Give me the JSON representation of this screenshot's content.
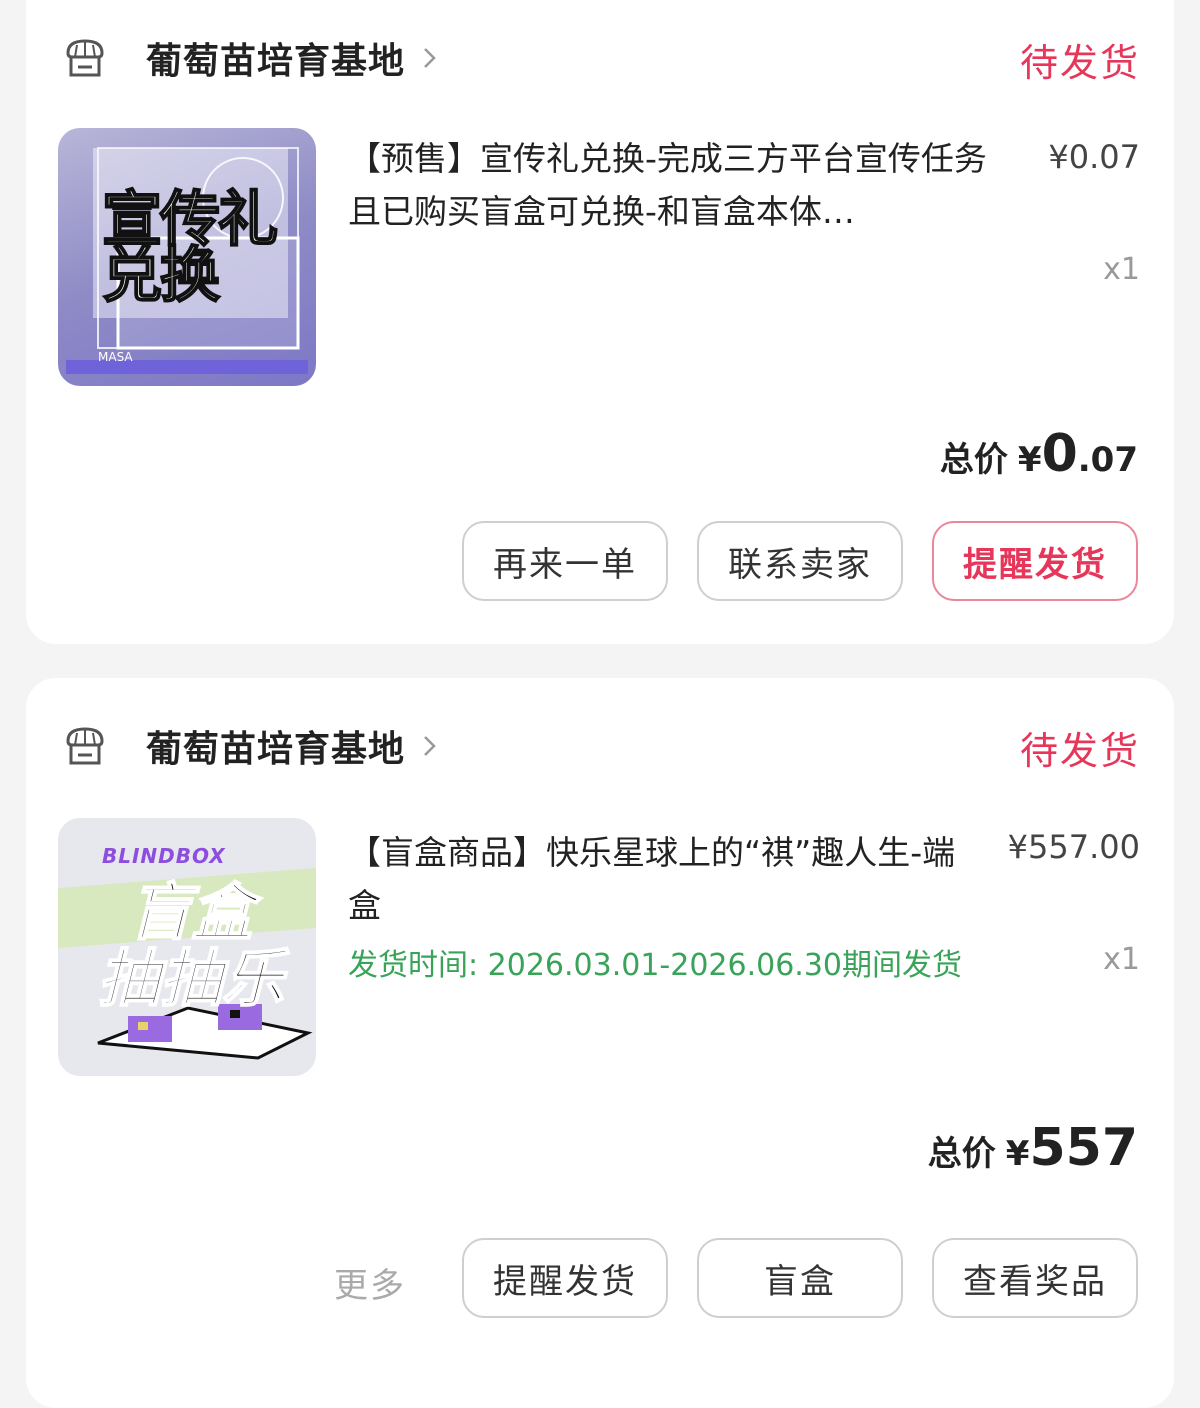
{
  "orders": [
    {
      "shop_name": "葡萄苗培育基地",
      "status": "待发货",
      "thumb_text": [
        "宣传礼",
        "兑换"
      ],
      "thumb_logo": "MASA",
      "title": "【预售】宣传礼兑换-完成三方平台宣传任务且已购买盲盒可兑换-和盲盒本体…",
      "price": "¥0.07",
      "qty": "x1",
      "total_label": "总价",
      "total_yen": "¥",
      "total_int": "0",
      "total_dec": ".07",
      "buttons": [
        "再来一单",
        "联系卖家",
        "提醒发货"
      ]
    },
    {
      "shop_name": "葡萄苗培育基地",
      "status": "待发货",
      "thumb_brand": "BLINDBOX",
      "thumb_text": [
        "盲盒",
        "抽抽乐"
      ],
      "title": "【盲盒商品】快乐星球上的“祺”趣人生-端盒",
      "shipping": "发货时间: 2026.03.01-2026.06.30期间发货",
      "price": "¥557.00",
      "qty": "x1",
      "total_label": "总价",
      "total_yen": "¥",
      "total_int": "557",
      "total_dec": "",
      "more_label": "更多",
      "buttons": [
        "提醒发货",
        "盲盒",
        "查看奖品"
      ]
    }
  ],
  "colors": {
    "status": "#e6375a",
    "shipping": "#3aa35a",
    "background": "#f4f4f4"
  },
  "icons": {
    "shop": "shop-icon",
    "chevron": "chevron-right-icon"
  }
}
